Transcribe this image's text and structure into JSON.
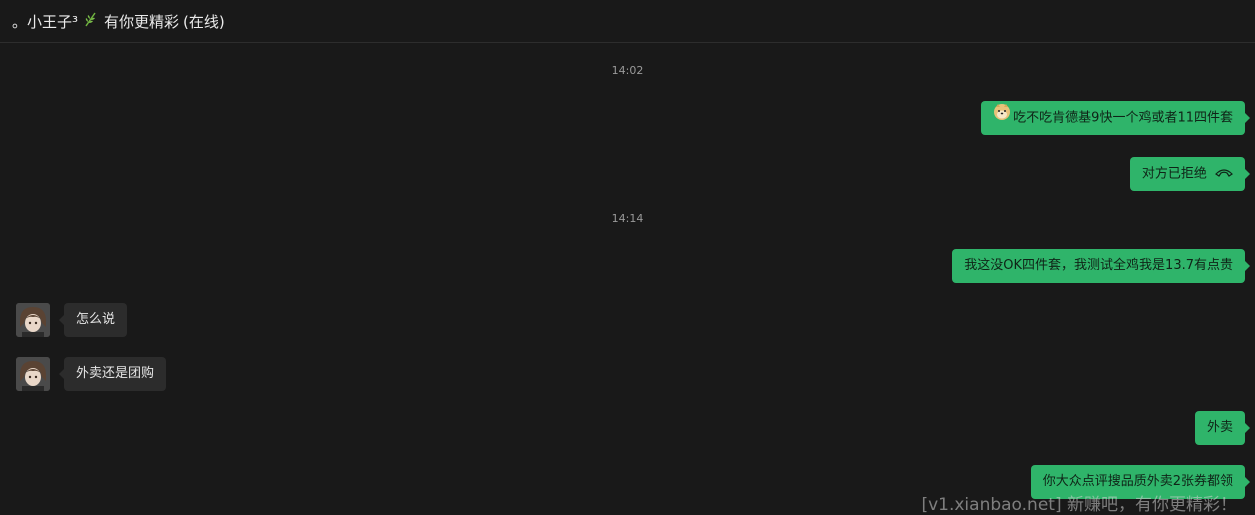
{
  "header": {
    "contact_prefix": "。小王子³",
    "contact_suffix": "有你更精彩",
    "status": "(在线)"
  },
  "messages": {
    "time1": "14:02",
    "m1": "吃不吃肯德基9快一个鸡或者11四件套",
    "m2": "对方已拒绝",
    "time2": "14:14",
    "m3": "我这没OK四件套，我测试全鸡我是13.7有点贵",
    "m4": "怎么说",
    "m5": "外卖还是团购",
    "m6": "外卖",
    "m7": "你大众点评搜品质外卖2张券都领"
  },
  "watermark": "[v1.xianbao.net] 新赚吧，有你更精彩！",
  "colors": {
    "background": "#191919",
    "my_bubble": "#2fb46a",
    "other_bubble": "#2c2c2c"
  },
  "icons": {
    "header_leaf": "leaf-icon",
    "doge_emoji": "doge-emoji-icon",
    "call_declined": "phone-hangup-icon"
  }
}
